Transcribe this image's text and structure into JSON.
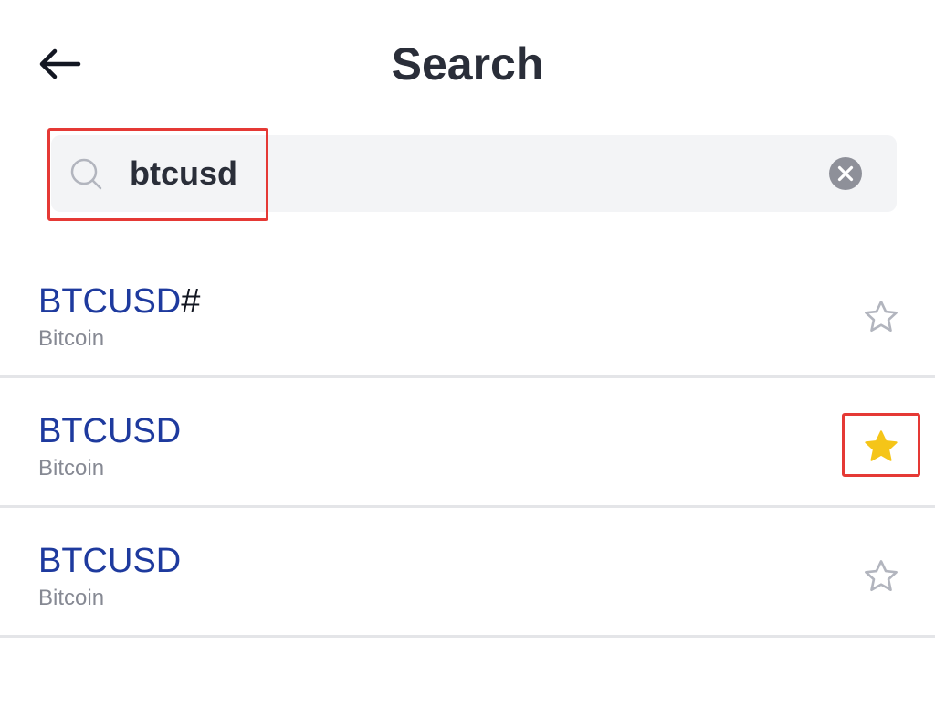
{
  "header": {
    "back_icon": "arrow-left-icon",
    "title": "Search"
  },
  "search": {
    "icon": "search-icon",
    "value": "btcusd",
    "clear_icon": "clear-circle-icon"
  },
  "results": [
    {
      "symbol": "BTCUSD",
      "symbol_suffix": "#",
      "description": "Bitcoin",
      "favorited": false,
      "star_icon": "star-outline-icon"
    },
    {
      "symbol": "BTCUSD",
      "symbol_suffix": "",
      "description": "Bitcoin",
      "favorited": true,
      "star_icon": "star-filled-icon"
    },
    {
      "symbol": "BTCUSD",
      "symbol_suffix": "",
      "description": "Bitcoin",
      "favorited": false,
      "star_icon": "star-outline-icon"
    }
  ],
  "colors": {
    "symbol": "#1e3a9e",
    "star_filled": "#f5c518",
    "highlight": "#e53935"
  }
}
